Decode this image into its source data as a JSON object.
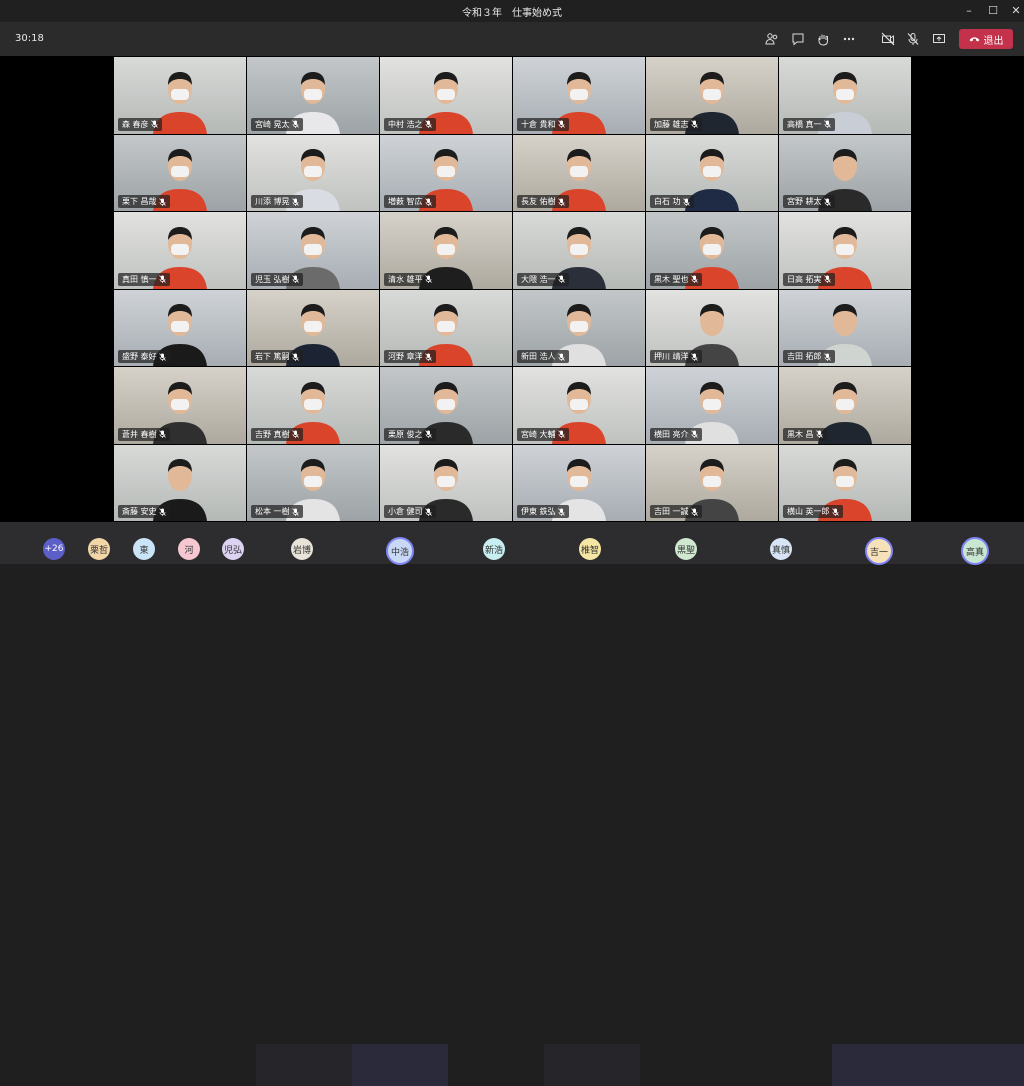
{
  "window": {
    "title": "令和３年　仕事始め式",
    "minimize_icon": "minimize-icon",
    "maximize_icon": "maximize-icon",
    "close_icon": "close-icon"
  },
  "toolbar": {
    "timer": "30:18",
    "leave_label": "退出",
    "icons": [
      "participants-icon",
      "chat-icon",
      "raise-hand-icon",
      "more-icon",
      "camera-off-icon",
      "mic-off-icon",
      "share-screen-icon"
    ]
  },
  "colors": {
    "leave": "#c4314b",
    "accent": "#5b5fc7",
    "titlebar": "#202020",
    "toolbar": "#2b2b2b"
  },
  "participants": [
    {
      "name": "森 春彦",
      "shirt": "#d9442b",
      "mask": true
    },
    {
      "name": "宮崎 晃太",
      "shirt": "#e8e8ea",
      "mask": true
    },
    {
      "name": "中村 浩之",
      "shirt": "#d9442b",
      "mask": true
    },
    {
      "name": "十倉 貴和",
      "shirt": "#d9442b",
      "mask": true
    },
    {
      "name": "加藤 雄志",
      "shirt": "#1f2630",
      "mask": true
    },
    {
      "name": "高橋 真一",
      "shirt": "#c9ced6",
      "mask": true
    },
    {
      "name": "栗下 昌哉",
      "shirt": "#d9442b",
      "mask": true
    },
    {
      "name": "川添 博晃",
      "shirt": "#d9dde3",
      "mask": true
    },
    {
      "name": "増薮 智広",
      "shirt": "#d9442b",
      "mask": true
    },
    {
      "name": "長友 佑樹",
      "shirt": "#d9442b",
      "mask": true
    },
    {
      "name": "白石 功",
      "shirt": "#1f2b45",
      "mask": true
    },
    {
      "name": "宮野 耕太",
      "shirt": "#2a2a2a",
      "mask": false
    },
    {
      "name": "真田 慎一",
      "shirt": "#d9442b",
      "mask": true
    },
    {
      "name": "児玉 弘樹",
      "shirt": "#6b6b6b",
      "mask": true
    },
    {
      "name": "清水 雄平",
      "shirt": "#1e1e1e",
      "mask": true
    },
    {
      "name": "大隈 浩一",
      "shirt": "#2a2f3a",
      "mask": true
    },
    {
      "name": "黒木 聖也",
      "shirt": "#d9442b",
      "mask": true
    },
    {
      "name": "日高 拓実",
      "shirt": "#d9442b",
      "mask": true
    },
    {
      "name": "盛野 泰好",
      "shirt": "#1a1a1a",
      "mask": true
    },
    {
      "name": "岩下 篤嗣",
      "shirt": "#1c2433",
      "mask": true
    },
    {
      "name": "河野 章洋",
      "shirt": "#d9442b",
      "mask": true
    },
    {
      "name": "新田 浩人",
      "shirt": "#e0e0e0",
      "mask": true
    },
    {
      "name": "押川 靖洋",
      "shirt": "#444444",
      "mask": false
    },
    {
      "name": "吉田 拓郎",
      "shirt": "#cfd4d0",
      "mask": false
    },
    {
      "name": "蒼井 春樹",
      "shirt": "#2f2f2f",
      "mask": true
    },
    {
      "name": "吉野 真樹",
      "shirt": "#d9442b",
      "mask": true
    },
    {
      "name": "栗原 俊之",
      "shirt": "#2a2a2a",
      "mask": true
    },
    {
      "name": "宮崎 大輔",
      "shirt": "#d9442b",
      "mask": true
    },
    {
      "name": "横田 亮介",
      "shirt": "#e0e0e0",
      "mask": true
    },
    {
      "name": "黒木 昌",
      "shirt": "#1f2630",
      "mask": true
    },
    {
      "name": "斎藤 安史",
      "shirt": "#1a1a1a",
      "mask": false
    },
    {
      "name": "松本 一樹",
      "shirt": "#e4e4e4",
      "mask": true
    },
    {
      "name": "小倉 健司",
      "shirt": "#2a2a2a",
      "mask": true
    },
    {
      "name": "伊東 鉄弘",
      "shirt": "#e4e4e4",
      "mask": true
    },
    {
      "name": "吉田 一誠",
      "shirt": "#444444",
      "mask": true
    },
    {
      "name": "横山 英一郎",
      "shirt": "#d9442b",
      "mask": true
    }
  ],
  "bottom_bar": {
    "overflow_count": "+26",
    "avatars": [
      {
        "initials": "栗哲",
        "color": "#f3d6a8"
      },
      {
        "initials": "東",
        "color": "#c9e3f7"
      },
      {
        "initials": "河",
        "color": "#f4c7d1"
      },
      {
        "initials": "児弘",
        "color": "#dcd3f2"
      },
      {
        "initials": "岩博",
        "color": "#e7e3d8"
      },
      {
        "initials": "中浩",
        "color": "#c9d8f5"
      },
      {
        "initials": "新浩",
        "color": "#c7eef0"
      },
      {
        "initials": "椎智",
        "color": "#f5e6a3"
      },
      {
        "initials": "黒聖",
        "color": "#cfe8cf"
      },
      {
        "initials": "真慎",
        "color": "#d6e4f5"
      },
      {
        "initials": "吉一",
        "color": "#f7e1b9"
      },
      {
        "initials": "高真",
        "color": "#c8e6d0"
      }
    ]
  }
}
